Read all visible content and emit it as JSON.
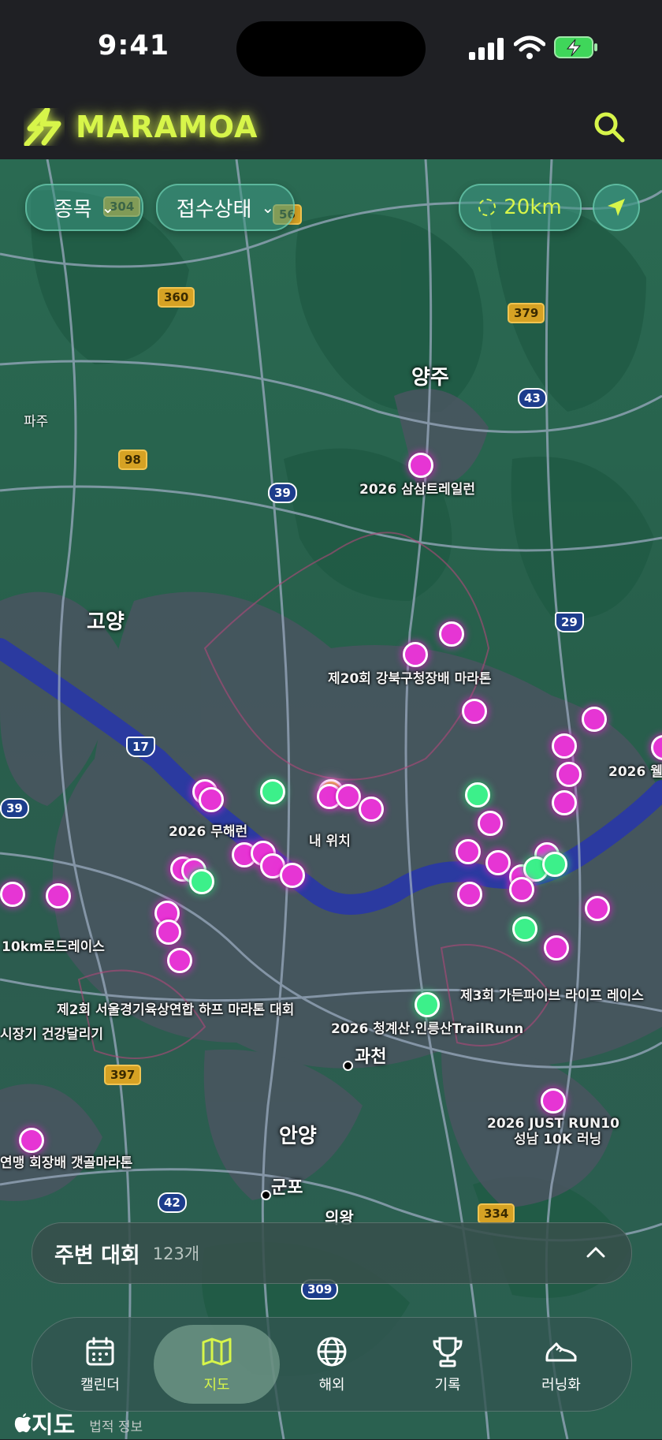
{
  "status": {
    "time": "9:41"
  },
  "header": {
    "brand": "MARAMOA"
  },
  "filters": {
    "category": "종목",
    "status": "접수상태",
    "radius": "20km"
  },
  "map": {
    "cities": [
      "양주",
      "고양",
      "안양",
      "과천",
      "군포",
      "파주",
      "의왕"
    ],
    "road_shields": [
      "56",
      "360",
      "379",
      "43",
      "98",
      "39",
      "29",
      "17",
      "39",
      "397",
      "42",
      "334",
      "309",
      "304"
    ],
    "my_location_label": "내 위치",
    "event_labels": [
      "2026 삼삼트레일런",
      "제20회 강북구청장배 마라톤",
      "2026 무해런",
      "2026 웰",
      "10km로드레이스",
      "제2회 서울경기육상연합 하프 마라톤 대회",
      "시장기 건강달리기",
      "2026 청계산.인릉산TrailRunn",
      "제3회 가든파이브 라이프 레이스",
      "2026 JUST RUN10",
      "성남 10K 러닝",
      "연맹 회장배 갯골마라톤"
    ]
  },
  "sheet": {
    "title": "주변 대회",
    "count": "123개"
  },
  "tabs": [
    {
      "label": "캘린더",
      "icon": "calendar-icon"
    },
    {
      "label": "지도",
      "icon": "map-icon",
      "active": true
    },
    {
      "label": "해외",
      "icon": "globe-icon"
    },
    {
      "label": "기록",
      "icon": "trophy-icon"
    },
    {
      "label": "러닝화",
      "icon": "shoe-icon"
    }
  ],
  "attribution": {
    "maps": "지도",
    "legal": "법적 정보"
  },
  "colors": {
    "accent": "#d7f54a",
    "pin_event": "#e635d4",
    "pin_open": "#3cf08a"
  }
}
